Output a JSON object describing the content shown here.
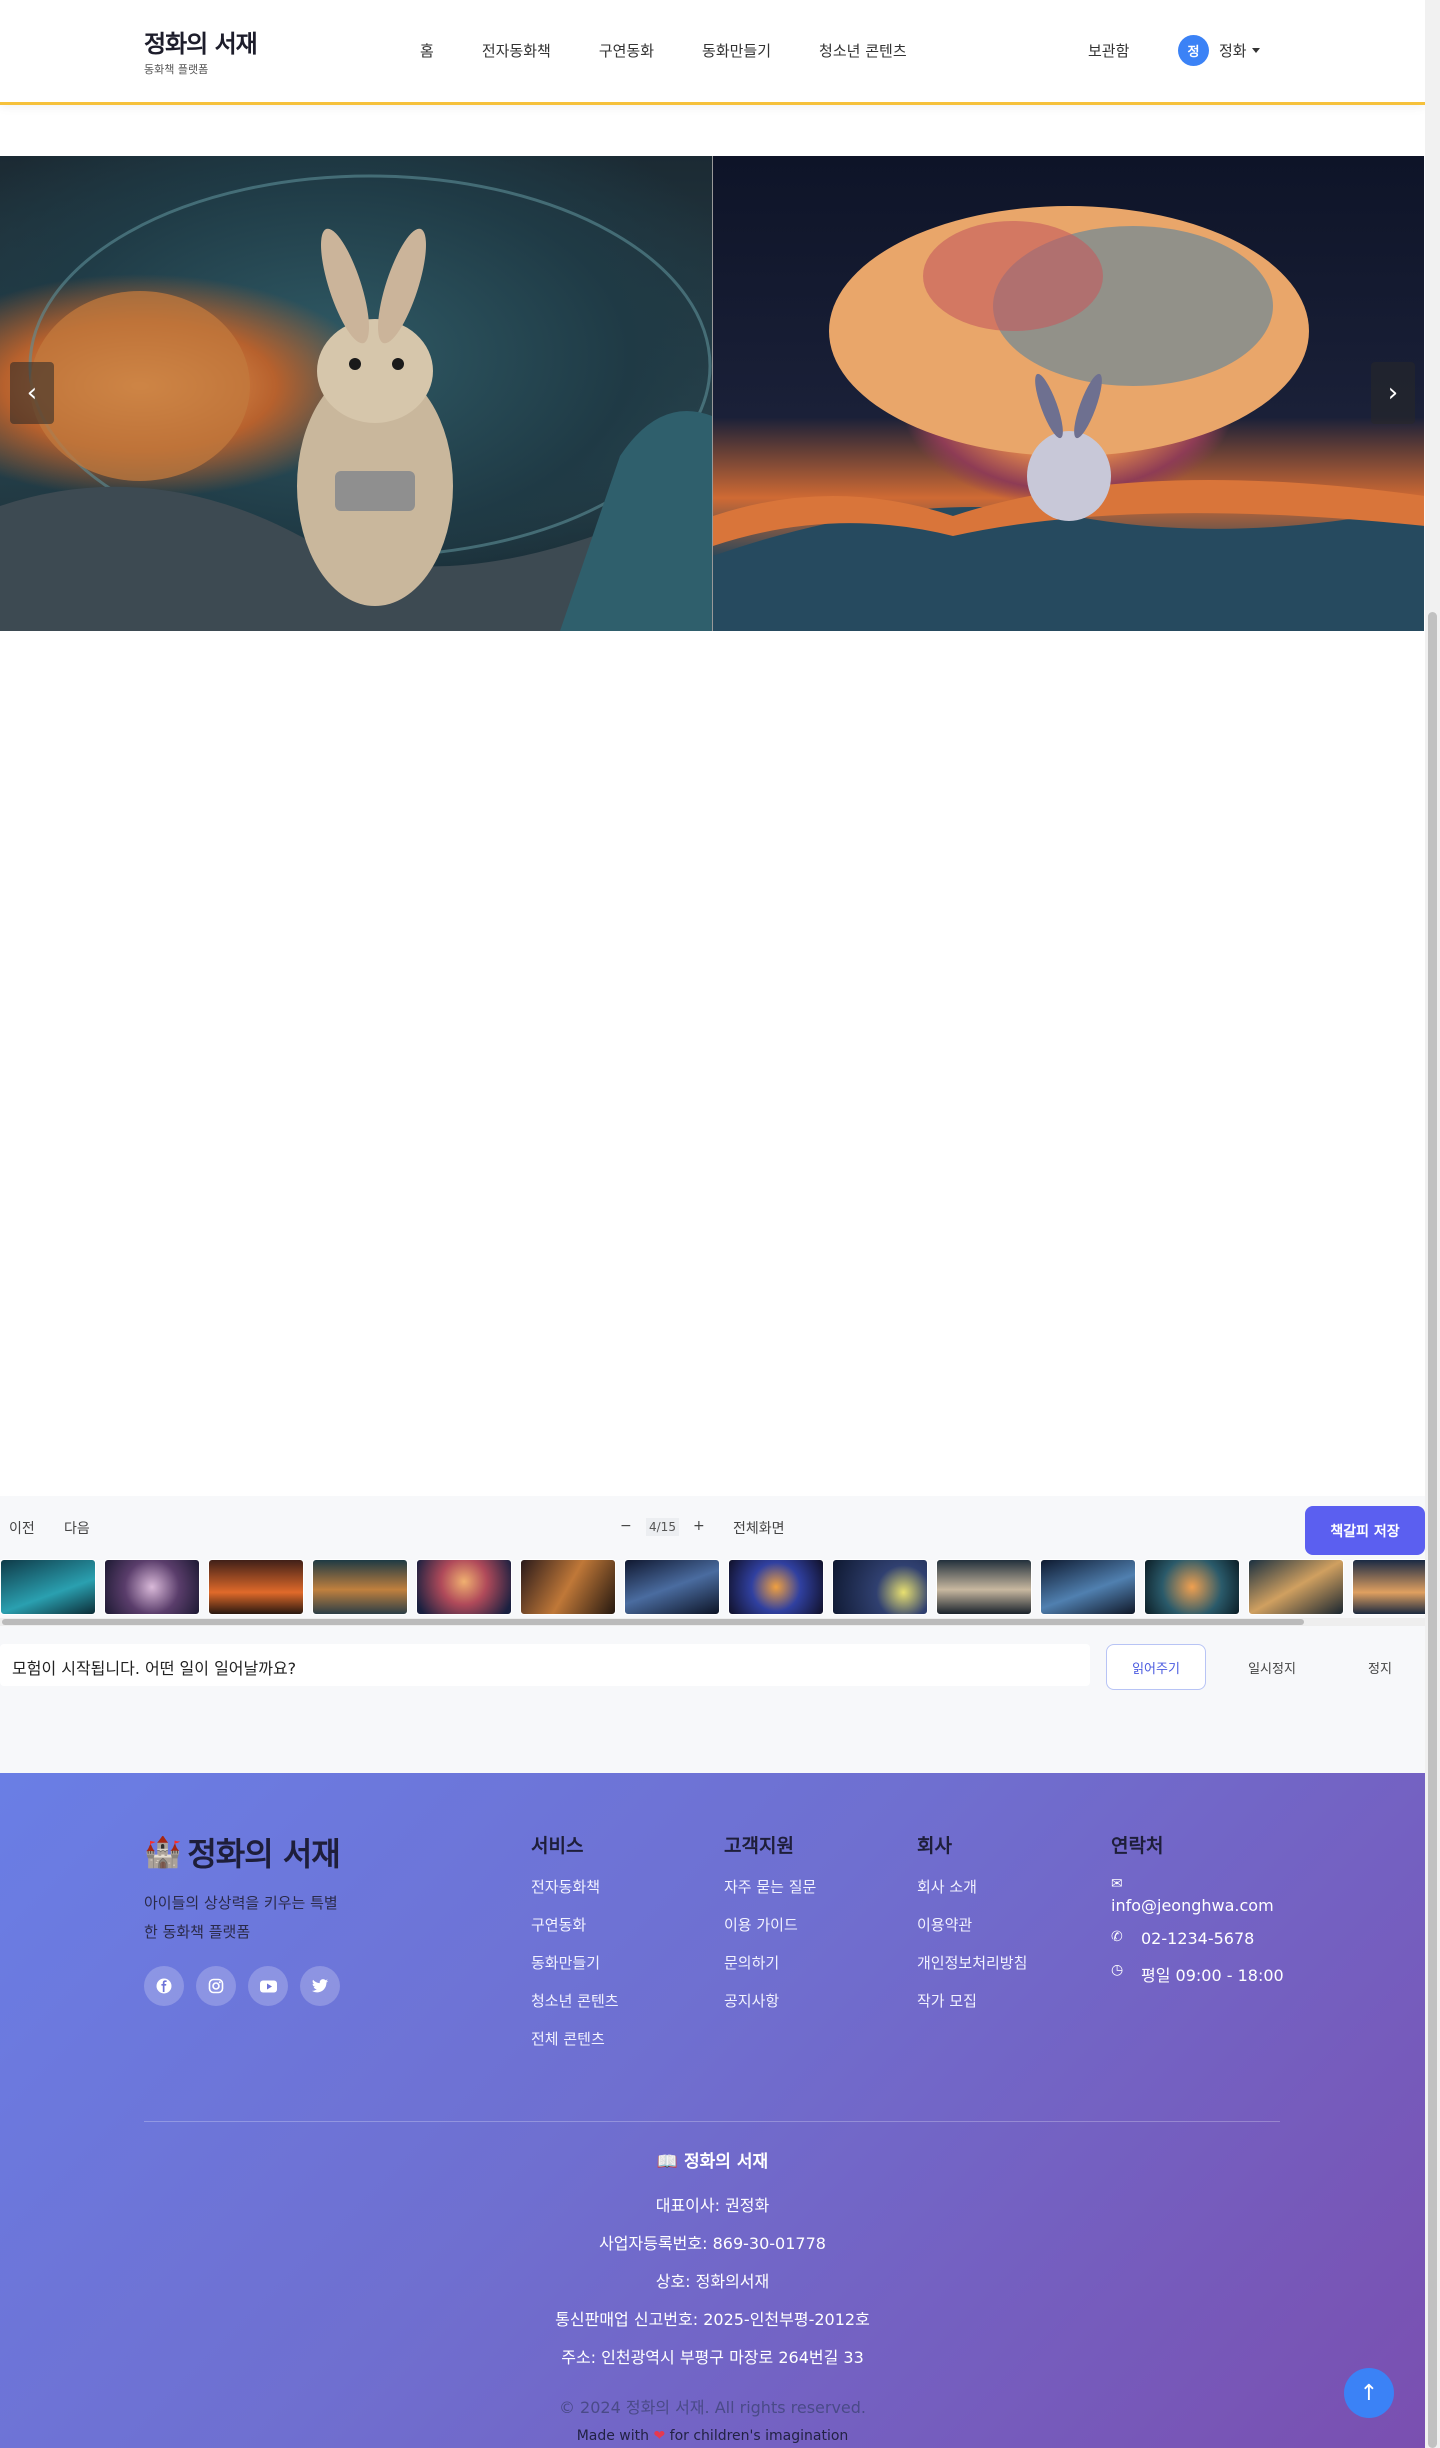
{
  "header": {
    "brand_title": "정화의 서재",
    "brand_subtitle": "동화책 플랫폼",
    "nav": [
      "홈",
      "전자동화책",
      "구연동화",
      "동화만들기",
      "청소년 콘텐츠"
    ],
    "vault": "보관함",
    "avatar_initial": "정",
    "user_name": "정화"
  },
  "viewer": {
    "prev_arrow": "‹",
    "next_arrow": "›"
  },
  "controls": {
    "prev": "이전",
    "next": "다음",
    "zoom_out": "−",
    "page_indicator": "4/15",
    "zoom_in": "+",
    "fullscreen": "전체화면",
    "bookmark": "책갈피 저장",
    "thumbnail_count": 14,
    "narration": "모험이 시작됩니다. 어떤 일이 일어날까요?",
    "read_button": "읽어주기",
    "pause_button": "일시정지",
    "stop_button": "정지"
  },
  "footer": {
    "title": "정화의 서재",
    "description": "아이들의 상상력을 키우는 특별한 동화책 플랫폼",
    "social_icons": [
      "facebook-icon",
      "instagram-icon",
      "youtube-icon",
      "twitter-icon"
    ],
    "columns": [
      {
        "heading": "서비스",
        "links": [
          "전자동화책",
          "구연동화",
          "동화만들기",
          "청소년 콘텐츠",
          "전체 콘텐츠"
        ]
      },
      {
        "heading": "고객지원",
        "links": [
          "자주 묻는 질문",
          "이용 가이드",
          "문의하기",
          "공지사항"
        ]
      },
      {
        "heading": "회사",
        "links": [
          "회사 소개",
          "이용약관",
          "개인정보처리방침",
          "작가 모집"
        ]
      }
    ],
    "contact": {
      "heading": "연락처",
      "email": "info@jeonghwa.com",
      "phone": "02-1234-5678",
      "hours": "평일 09:00 - 18:00"
    },
    "bottom_title": "정화의 서재",
    "ceo": "대표이사: 권정화",
    "biz_no": "사업자등록번호: 869-30-01778",
    "trade_name": "상호: 정화의서재",
    "ecommerce_no": "통신판매업 신고번호: 2025-인천부평-2012호",
    "address": "주소: 인천광역시 부평구 마장로 264번길 33",
    "copyright": "© 2024 정화의 서재. All rights reserved.",
    "made_with_prefix": "Made with",
    "made_with_suffix": "for children's imagination"
  },
  "colors": {
    "accent_yellow": "#f6c13b",
    "primary_blue": "#3b82f6",
    "bookmark_purple": "#5b5ff0",
    "footer_start": "#6a7ee5",
    "footer_end": "#7a4fb0"
  }
}
